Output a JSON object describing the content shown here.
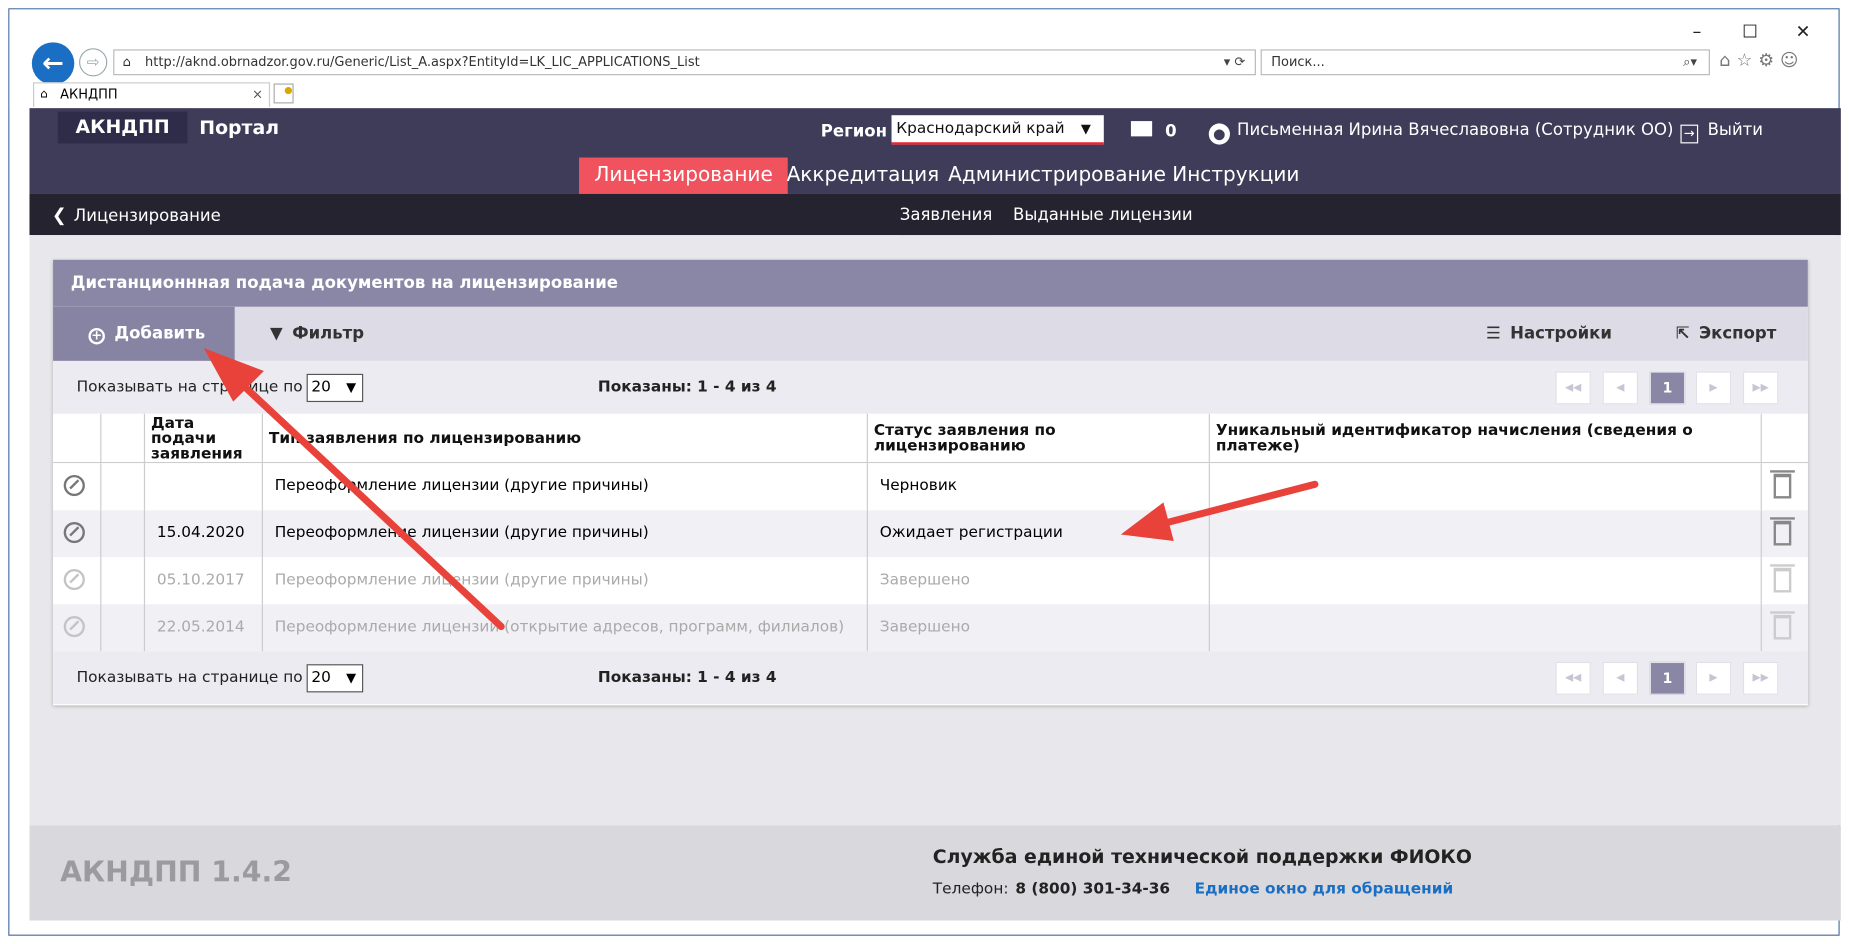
{
  "browser": {
    "url": "http://aknd.obrnadzor.gov.ru/Generic/List_A.aspx?EntityId=LK_LIC_APPLICATIONS_List",
    "url_dropdown": "▾ ⟳",
    "search_placeholder": "Поиск...",
    "search_icon": "⌕▾",
    "tab_title": "АКНДПП",
    "win_minimize": "–",
    "win_maximize": "☐",
    "win_close": "✕",
    "toolbar_icons": "⌂☆⚙☺"
  },
  "header": {
    "logo": "АКНДПП",
    "portal": "Портал",
    "region_label": "Регион",
    "region_value": "Краснодарский край",
    "mail_count": "0",
    "user": "Письменная Ирина Вячеславовна (Сотрудник ОО)",
    "exit": "Выйти",
    "menu": [
      "Лицензирование",
      "Аккредитация",
      "Администрирование",
      "Инструкции"
    ],
    "active_menu": "Лицензирование"
  },
  "subnav": {
    "back": "Лицензирование",
    "tabs": [
      "Заявления",
      "Выданные лицензии"
    ],
    "active_tab": "Заявления"
  },
  "panel": {
    "title": "Дистанционнная подача документов на лицензирование",
    "add": "Добавить",
    "filter": "Фильтр",
    "settings": "Настройки",
    "export": "Экспорт",
    "per_page_label": "Показывать на странице по",
    "per_page": "20",
    "shown": "Показаны: 1 - 4 из 4",
    "current_page": "1",
    "columns": [
      "Дата подачи заявления",
      "Тип заявления по лицензированию",
      "Статус заявления по лицензированию",
      "Уникальный идентификатор начисления (сведения о платеже)"
    ],
    "rows": [
      {
        "date": "",
        "type": "Переоформление лицензии (другие причины)",
        "status": "Черновик",
        "uin": ""
      },
      {
        "date": "15.04.2020",
        "type": "Переоформление лицензии (другие причины)",
        "status": "Ожидает регистрации",
        "uin": ""
      },
      {
        "date": "05.10.2017",
        "type": "Переоформление лицензии (другие причины)",
        "status": "Завершено",
        "uin": ""
      },
      {
        "date": "22.05.2014",
        "type": "Переоформление лицензии (открытие адресов, программ, филиалов)",
        "status": "Завершено",
        "uin": ""
      }
    ]
  },
  "footer": {
    "version": "АКНДПП 1.4.2",
    "support": "Служба единой технической поддержки ФИОКО",
    "phone_label": "Телефон:",
    "phone": "8 (800) 301-34-36",
    "window_link": "Единое окно для обращений"
  },
  "colors": {
    "header_bg": "#3e3c58",
    "accent": "#f0525e",
    "panel_header": "#8a87a6",
    "arrow": "#e8423a",
    "link": "#1a6fc4"
  }
}
